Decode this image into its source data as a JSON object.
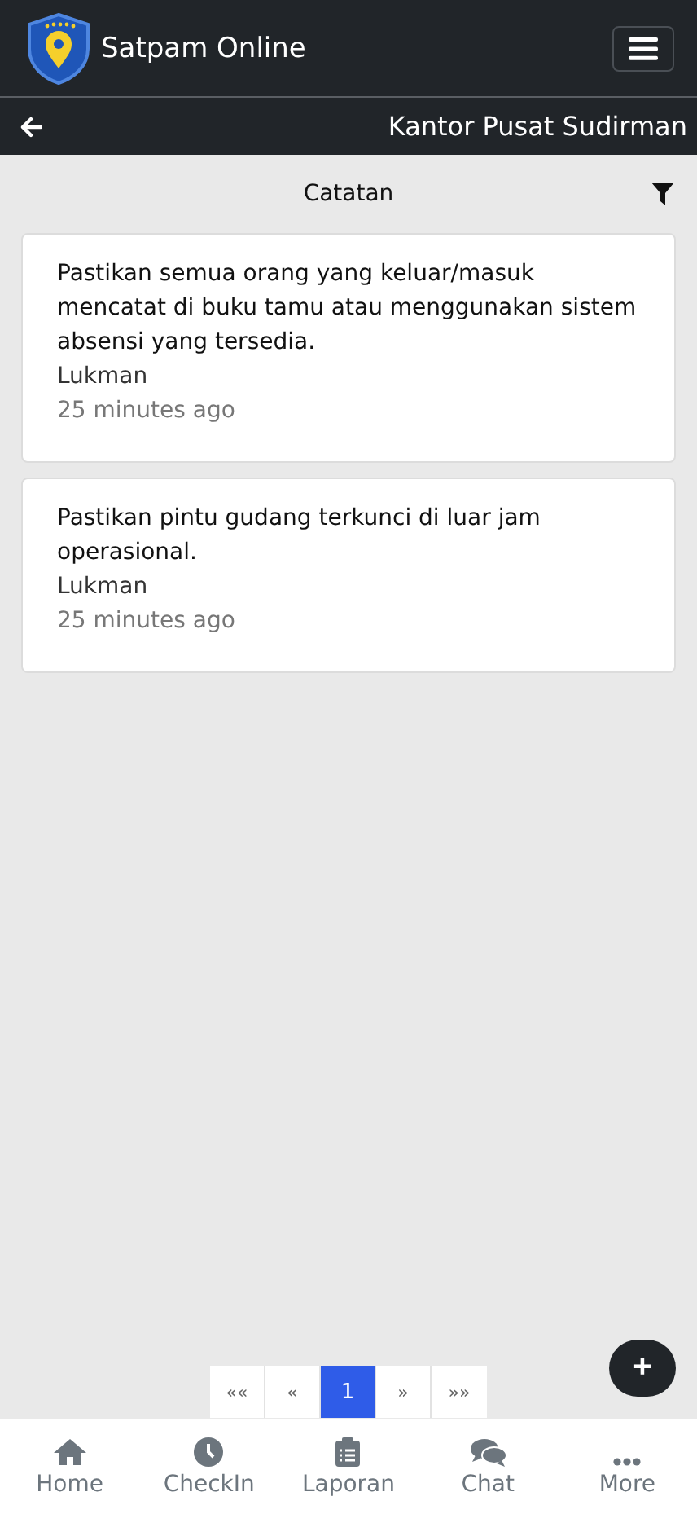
{
  "app": {
    "title": "Satpam Online"
  },
  "subheader": {
    "title": "Kantor Pusat Sudirman"
  },
  "section": {
    "title": "Catatan"
  },
  "notes": [
    {
      "text": "Pastikan semua orang yang keluar/masuk mencatat di buku tamu atau menggunakan sistem absensi yang tersedia.",
      "author": "Lukman",
      "time": "25 minutes ago"
    },
    {
      "text": "Pastikan pintu gudang terkunci di luar jam operasional.",
      "author": "Lukman",
      "time": "25 minutes ago"
    }
  ],
  "pagination": [
    {
      "label": "««",
      "selected": false
    },
    {
      "label": "«",
      "selected": false
    },
    {
      "label": "1",
      "selected": true
    },
    {
      "label": "»",
      "selected": false
    },
    {
      "label": "»»",
      "selected": false
    }
  ],
  "fab": {
    "label": "+"
  },
  "nav": [
    {
      "kind": "home",
      "label": "Home"
    },
    {
      "kind": "clock",
      "label": "CheckIn"
    },
    {
      "kind": "clipboard",
      "label": "Laporan"
    },
    {
      "kind": "chat",
      "label": "Chat"
    },
    {
      "kind": "more",
      "label": "More"
    }
  ]
}
